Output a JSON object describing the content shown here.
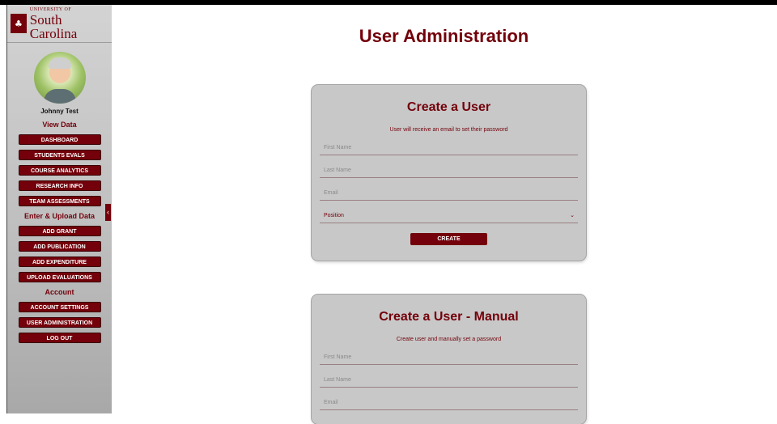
{
  "brand": {
    "logo_top": "UNIVERSITY OF",
    "logo_bottom": "South Carolina",
    "colors": {
      "garnet": "#73000a",
      "panel": "#c8c8c8"
    }
  },
  "sidebar": {
    "user_name": "Johnny Test",
    "view_data_title": "View Data",
    "view_data_items": [
      "DASHBOARD",
      "STUDENTS EVALS",
      "COURSE ANALYTICS",
      "RESEARCH INFO",
      "TEAM ASSESSMENTS"
    ],
    "upload_title": "Enter & Upload Data",
    "upload_items": [
      "ADD GRANT",
      "ADD PUBLICATION",
      "ADD EXPENDITURE",
      "UPLOAD EVALUATIONS"
    ],
    "account_title": "Account",
    "account_items": [
      "ACCOUNT SETTINGS",
      "USER ADMINISTRATION",
      "LOG OUT"
    ],
    "collapse_icon": "‹"
  },
  "main": {
    "page_title": "User Administration",
    "create_user": {
      "title": "Create a User",
      "subtitle": "User will receive an email to set their password",
      "first_name_placeholder": "First Name",
      "last_name_placeholder": "Last Name",
      "email_placeholder": "Email",
      "position_label": "Position",
      "chevron": "⌄",
      "button": "CREATE"
    },
    "create_manual": {
      "title": "Create a User - Manual",
      "subtitle": "Create user and manually set a password",
      "first_name_placeholder": "First Name",
      "last_name_placeholder": "Last Name",
      "email_placeholder": "Email"
    }
  }
}
